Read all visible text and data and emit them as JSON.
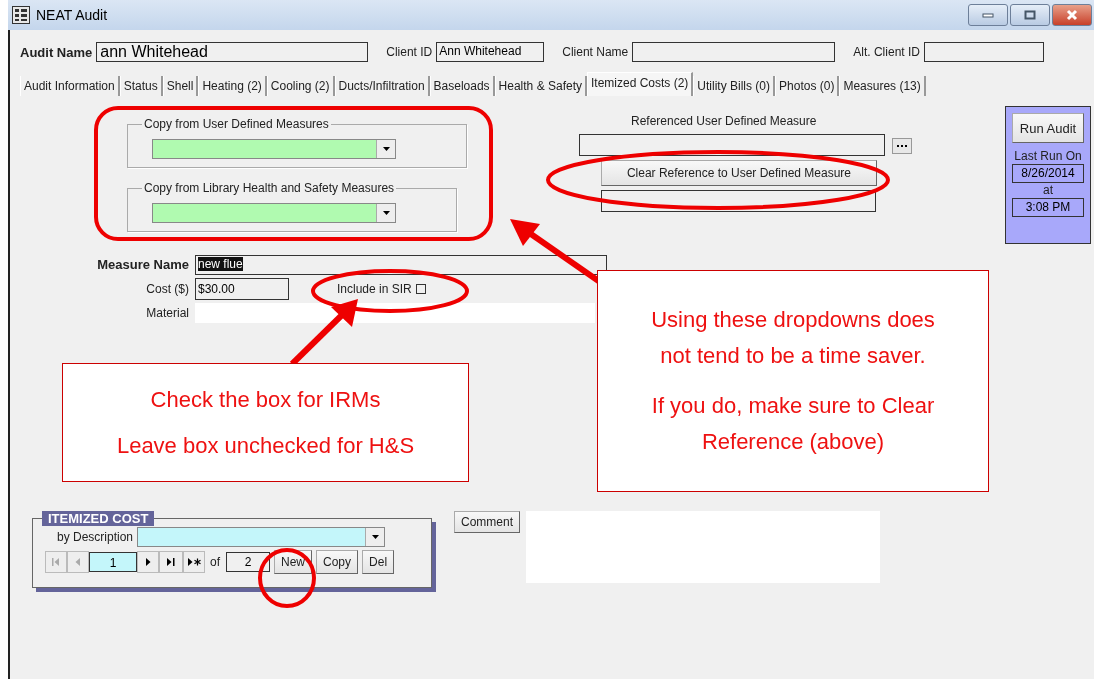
{
  "window": {
    "title": "NEAT Audit"
  },
  "header": [
    {
      "label": "Audit Name",
      "value": "ann Whitehead",
      "kind": "main"
    },
    {
      "label": "Client ID",
      "value": "Ann Whitehead",
      "kind": "plain"
    },
    {
      "label": "Client Name",
      "kind": "plain"
    },
    {
      "label": "Alt. Client ID",
      "kind": "plain"
    }
  ],
  "tabs": [
    {
      "label": "Audit Information",
      "selected": false
    },
    {
      "label": "Status",
      "selected": false
    },
    {
      "label": "Shell",
      "selected": false
    },
    {
      "label": "Heating (2)",
      "selected": false
    },
    {
      "label": "Cooling (2)",
      "selected": false
    },
    {
      "label": "Ducts/Infiltration",
      "selected": false
    },
    {
      "label": "Baseloads",
      "selected": false
    },
    {
      "label": "Health & Safety",
      "selected": false
    },
    {
      "label": "Itemized Costs (2)",
      "selected": true
    },
    {
      "label": "Utility Bills (0)",
      "selected": false
    },
    {
      "label": "Photos (0)",
      "selected": false
    },
    {
      "label": "Measures (13)",
      "selected": false
    }
  ],
  "copy_groups": [
    {
      "label": "Copy from User Defined Measures"
    },
    {
      "label": "Copy from Library Health and Safety Measures"
    }
  ],
  "reference": {
    "label": "Referenced User Defined Measure",
    "clear_button": "Clear Reference to User Defined Measure"
  },
  "run_panel": {
    "button": "Run Audit",
    "last_run_label": "Last Run On",
    "date": "8/26/2014",
    "at_label": "at",
    "time": "3:08 PM"
  },
  "measure": {
    "name_label": "Measure Name",
    "name_value": "new flue",
    "cost_label": "Cost ($)",
    "cost_value": "$30.00",
    "include_label": "Include in SIR",
    "include_checked": false,
    "material_label": "Material"
  },
  "itemized": {
    "title": "ITEMIZED COST",
    "by_label": "by Description",
    "record": "1",
    "of_label": "of",
    "total": "2",
    "buttons": [
      "New",
      "Copy",
      "Del"
    ],
    "comment_button": "Comment"
  },
  "callouts": [
    {
      "paragraphs": [
        "Check the box for IRMs",
        "Leave box unchecked for H&S"
      ]
    },
    {
      "paragraphs": [
        "Using these dropdowns does not tend to be a time saver.",
        "If you do, make sure to Clear Reference (above)"
      ]
    }
  ]
}
